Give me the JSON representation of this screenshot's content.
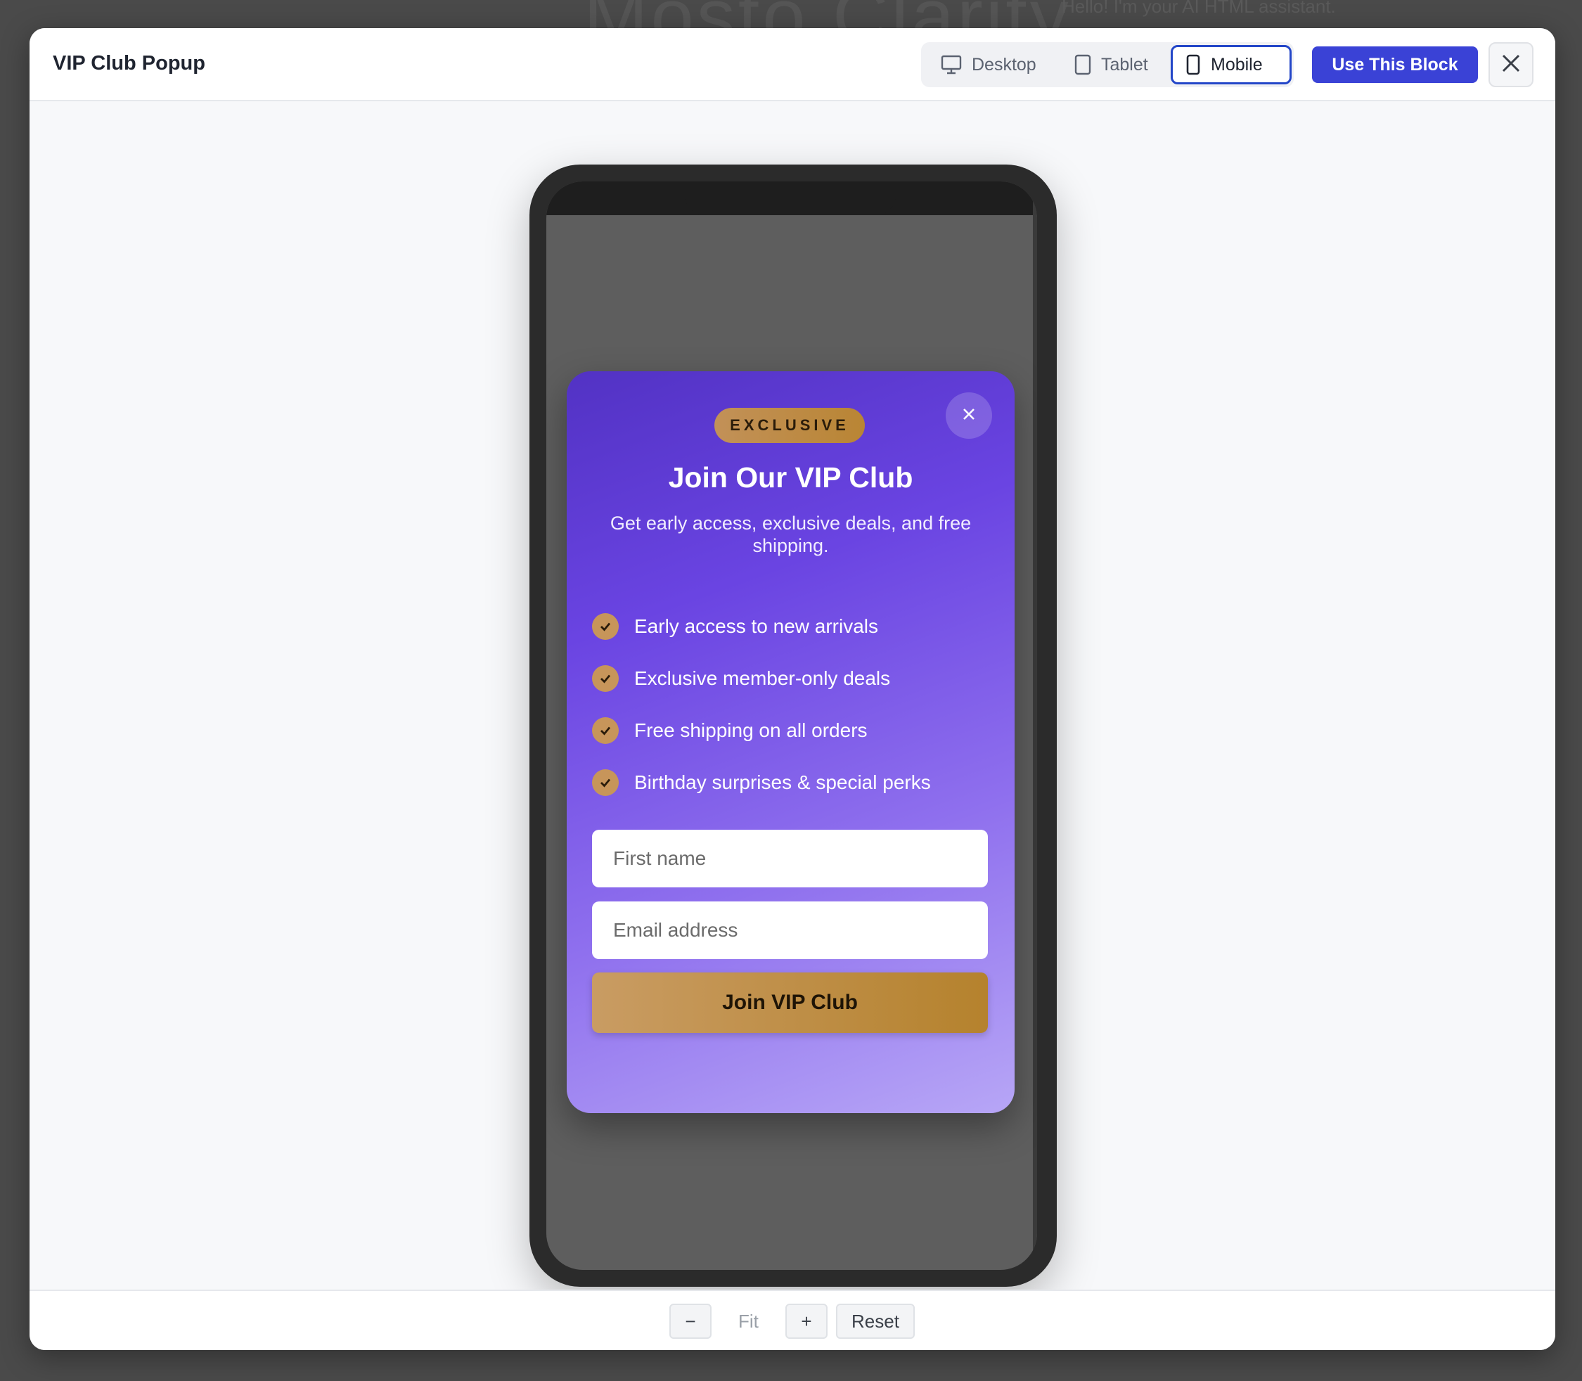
{
  "background_page": {
    "heading_fragment": "Mosto Clarity",
    "assistant_hint": "Hello! I'm your AI HTML assistant."
  },
  "modal": {
    "title": "VIP Club Popup",
    "devices": [
      {
        "label": "Desktop",
        "icon": "monitor-icon"
      },
      {
        "label": "Tablet",
        "icon": "tablet-icon"
      },
      {
        "label": "Mobile",
        "icon": "mobile-icon",
        "active": true
      }
    ],
    "use_block_label": "Use This Block",
    "close_icon": "close-icon"
  },
  "popup": {
    "badge": "EXCLUSIVE",
    "title": "Join Our VIP Club",
    "subtitle": "Get early access, exclusive deals, and free shipping.",
    "benefits": [
      "Early access to new arrivals",
      "Exclusive member-only deals",
      "Free shipping on all orders",
      "Birthday surprises & special perks"
    ],
    "first_name_placeholder": "First name",
    "email_placeholder": "Email address",
    "cta": "Join VIP Club",
    "colors": {
      "gradient_start": "#5232c4",
      "gradient_end": "#b7a6f6",
      "gold": "#c29158",
      "accent_blue": "#3a42d6"
    }
  },
  "zoom": {
    "minus": "−",
    "fit": "Fit",
    "plus": "+",
    "reset": "Reset"
  }
}
